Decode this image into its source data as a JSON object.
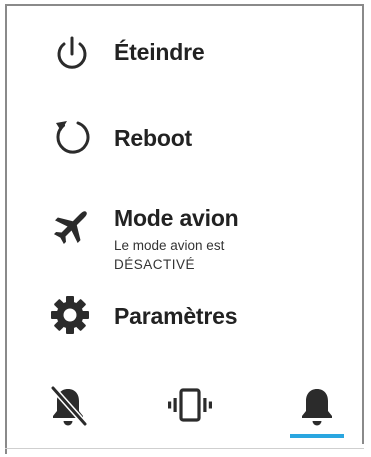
{
  "menu": {
    "power_off": {
      "label": "Éteindre",
      "icon": "power-icon"
    },
    "reboot": {
      "label": "Reboot",
      "icon": "refresh-icon"
    },
    "airplane": {
      "label": "Mode avion",
      "sub_line1": "Le mode avion est",
      "sub_line2": "DÉSACTIVÉ",
      "icon": "airplane-icon"
    },
    "settings": {
      "label": "Paramètres",
      "icon": "gear-icon"
    }
  },
  "sound_modes": {
    "items": [
      {
        "name": "silent",
        "icon": "bell-off-icon"
      },
      {
        "name": "vibrate",
        "icon": "vibrate-icon"
      },
      {
        "name": "sound",
        "icon": "bell-icon"
      }
    ],
    "selected": "sound"
  },
  "colors": {
    "icon": "#2b2b2b",
    "text": "#222222",
    "accent": "#2aa6e0",
    "border": "#8a8a8a"
  }
}
